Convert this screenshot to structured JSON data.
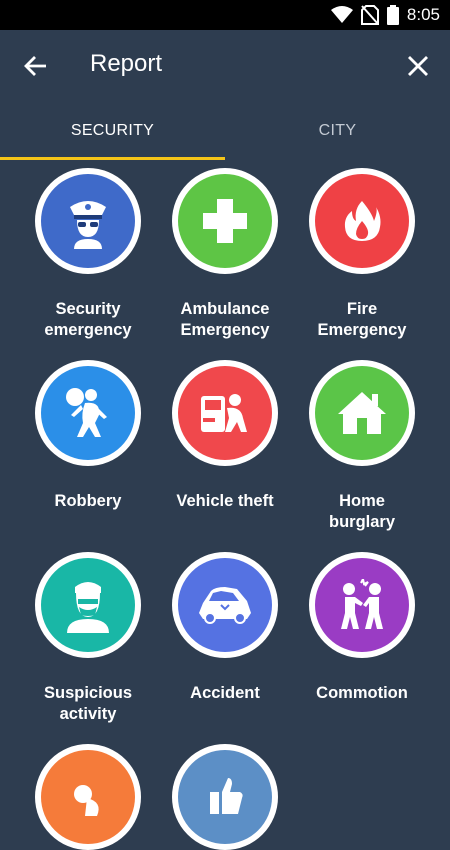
{
  "status_bar": {
    "time": "8:05"
  },
  "app_bar": {
    "title": "Report"
  },
  "tabs": [
    {
      "label": "SECURITY",
      "selected": true
    },
    {
      "label": "CITY",
      "selected": false
    }
  ],
  "colors": {
    "background": "#2e3d50",
    "tab_indicator": "#f5c518"
  },
  "categories": [
    {
      "label_line1": "Security",
      "label_line2": "emergency",
      "icon": "police-officer-icon",
      "color": "#3f6ac9"
    },
    {
      "label_line1": "Ambulance",
      "label_line2": "Emergency",
      "icon": "medical-cross-icon",
      "color": "#5ec545"
    },
    {
      "label_line1": "Fire",
      "label_line2": "Emergency",
      "icon": "flame-icon",
      "color": "#ef4145"
    },
    {
      "label_line1": "Robbery",
      "label_line2": "",
      "icon": "robber-icon",
      "color": "#2b8fe8"
    },
    {
      "label_line1": "Vehicle theft",
      "label_line2": "",
      "icon": "car-thief-icon",
      "color": "#f0484c"
    },
    {
      "label_line1": "Home",
      "label_line2": "burglary",
      "icon": "house-icon",
      "color": "#5bc548"
    },
    {
      "label_line1": "Suspicious",
      "label_line2": "activity",
      "icon": "masked-person-icon",
      "color": "#19b7a6"
    },
    {
      "label_line1": "Accident",
      "label_line2": "",
      "icon": "crashed-car-icon",
      "color": "#5572e2"
    },
    {
      "label_line1": "Commotion",
      "label_line2": "",
      "icon": "fight-icon",
      "color": "#9a3cc4"
    },
    {
      "label_line1": "",
      "label_line2": "",
      "icon": "injury-icon",
      "color": "#f57b3a"
    },
    {
      "label_line1": "",
      "label_line2": "",
      "icon": "thumbs-up-icon",
      "color": "#5c8fc6"
    }
  ]
}
